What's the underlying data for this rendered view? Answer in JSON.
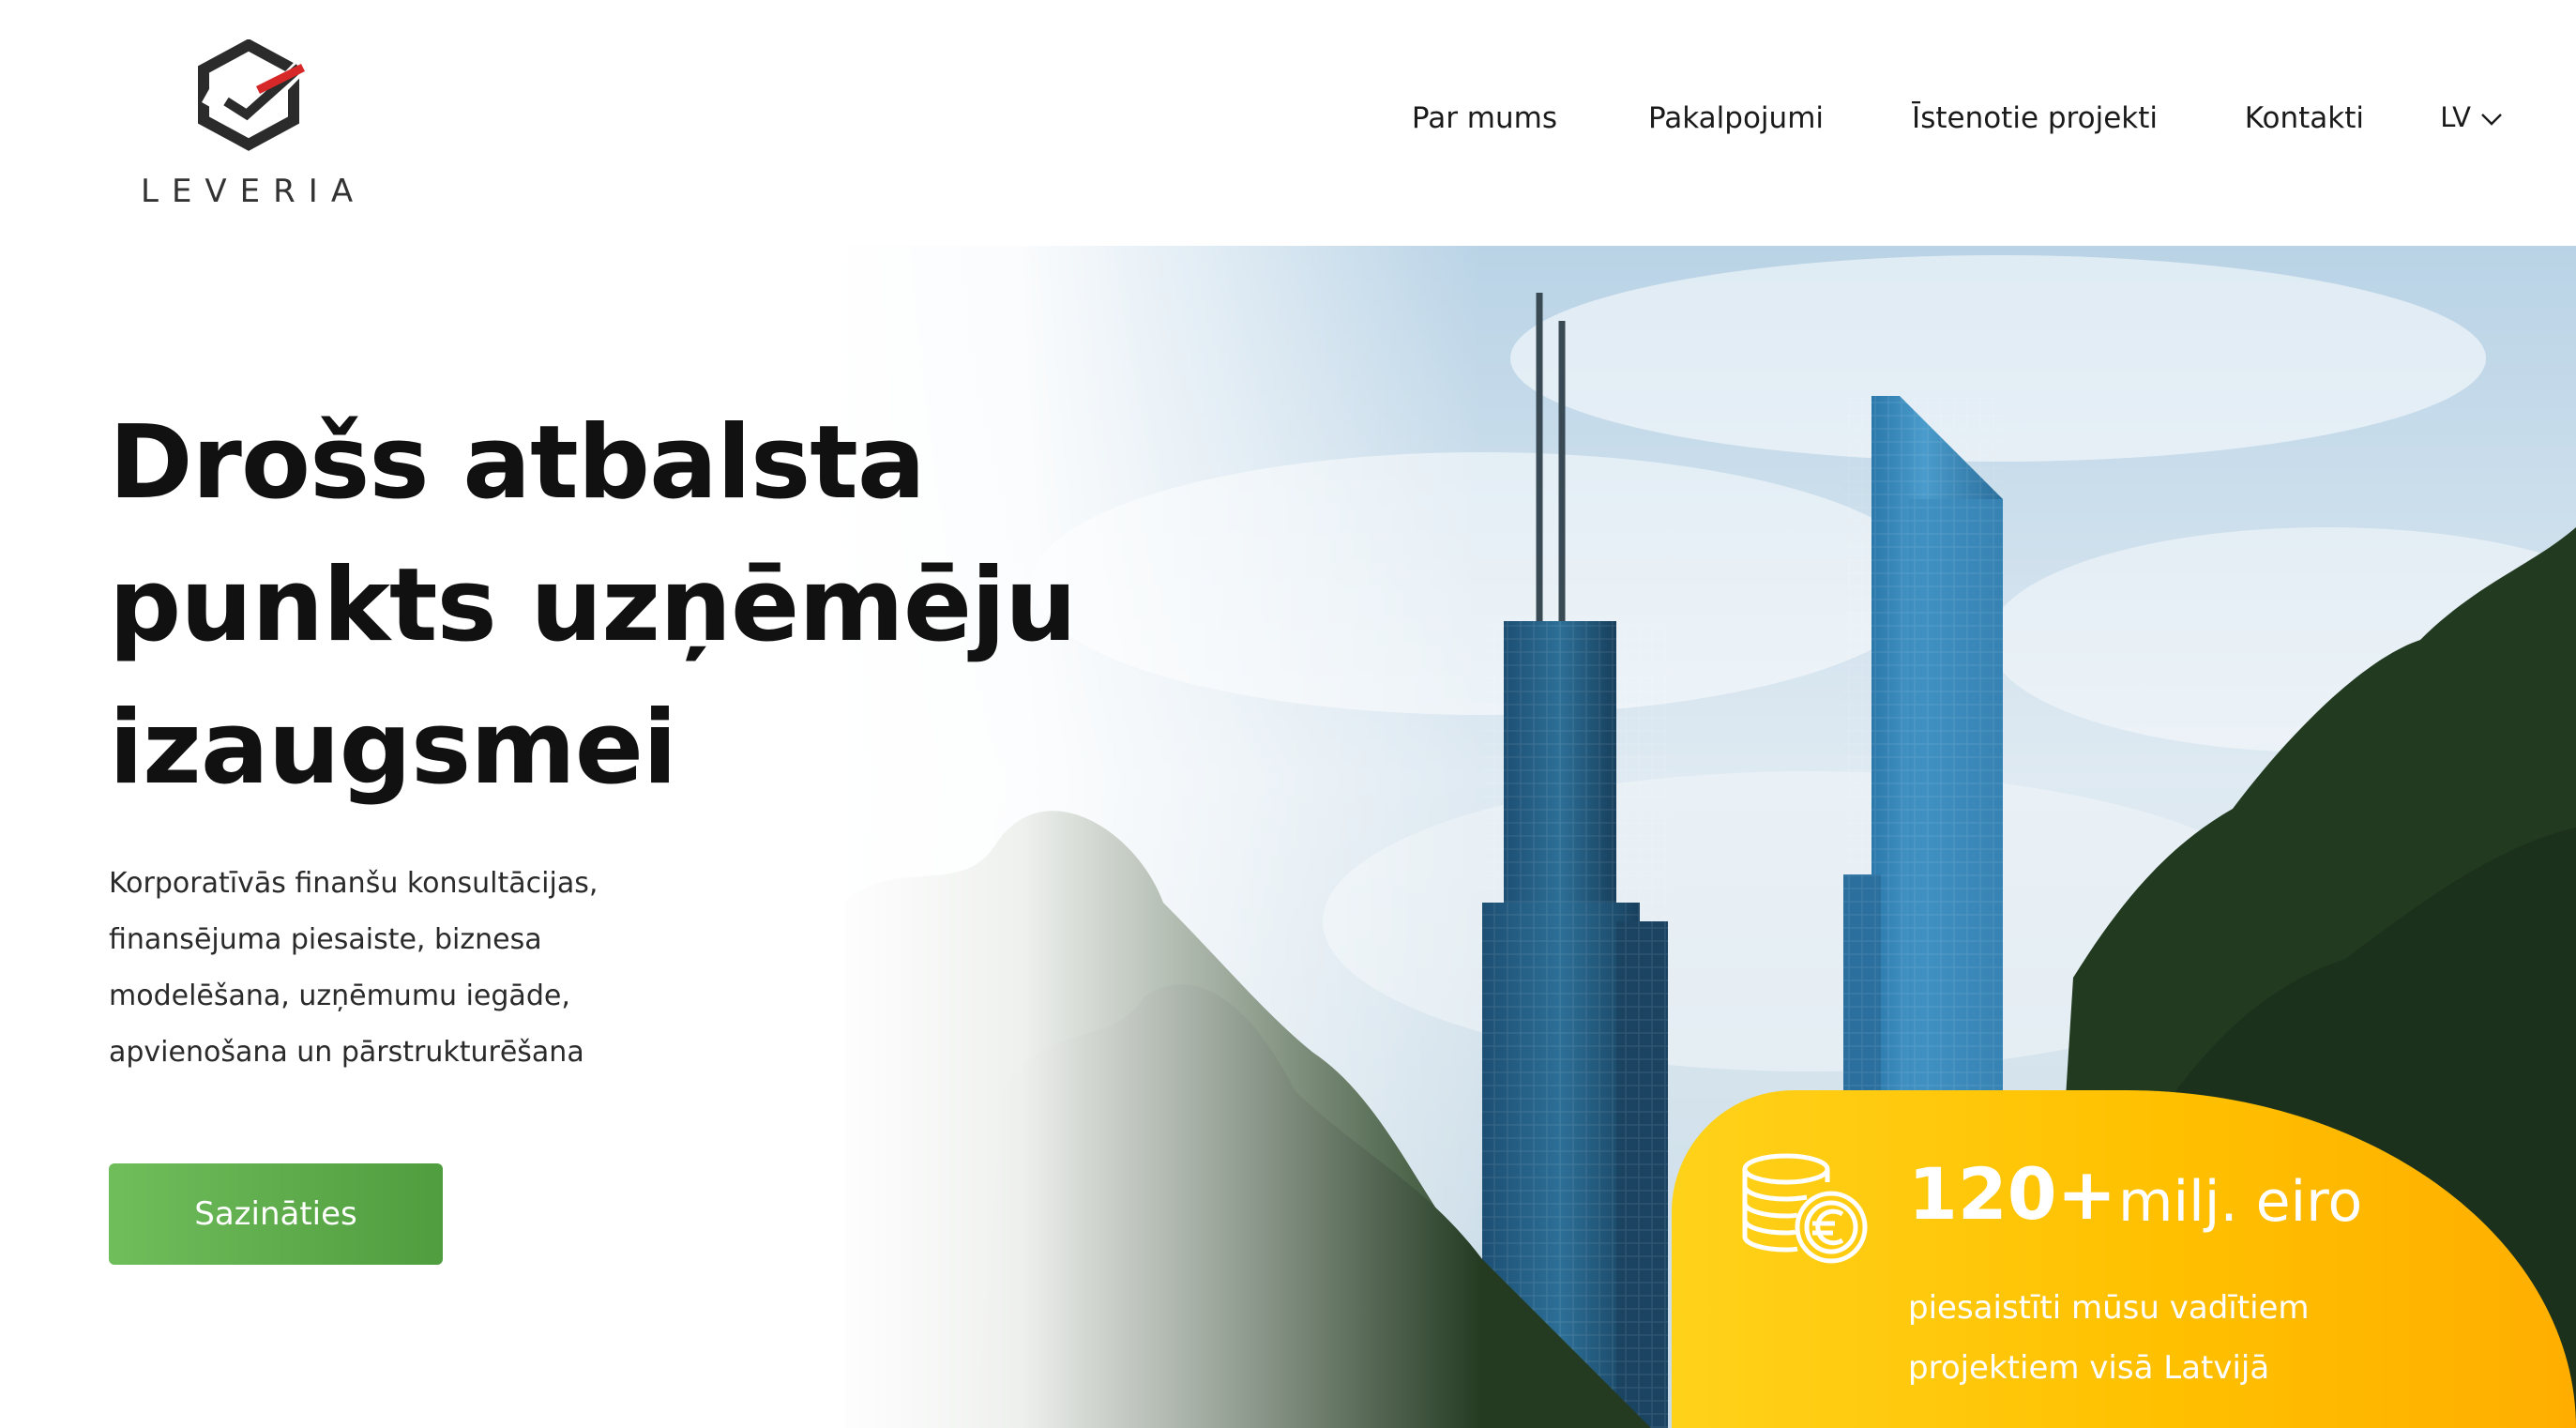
{
  "brand": {
    "name": "LEVERIA"
  },
  "nav": {
    "items": [
      {
        "label": "Par mums"
      },
      {
        "label": "Pakalpojumi"
      },
      {
        "label": "Īstenotie projekti"
      },
      {
        "label": "Kontakti"
      }
    ],
    "language": "LV"
  },
  "hero": {
    "headline": [
      "Drošs atbalsta",
      "punkts uzņēmēju",
      "izaugsmei"
    ],
    "subtitle": [
      "Korporatīvās finanšu konsultācijas,",
      "finansējuma piesaiste, biznesa",
      "modelēšana, uzņēmumu iegāde,",
      "apvienošana un pārstrukturēšana"
    ],
    "cta_label": "Sazināties"
  },
  "stat": {
    "number": "120+",
    "unit": "milj. eiro",
    "description": [
      "piesaistīti mūsu vadītiem",
      "projektiem visā Latvijā"
    ],
    "icon": "euro-coins-icon"
  },
  "colors": {
    "accent_green": "#5aa94a",
    "accent_yellow": "#ffc000",
    "logo_red": "#d62828",
    "text": "#111111"
  }
}
